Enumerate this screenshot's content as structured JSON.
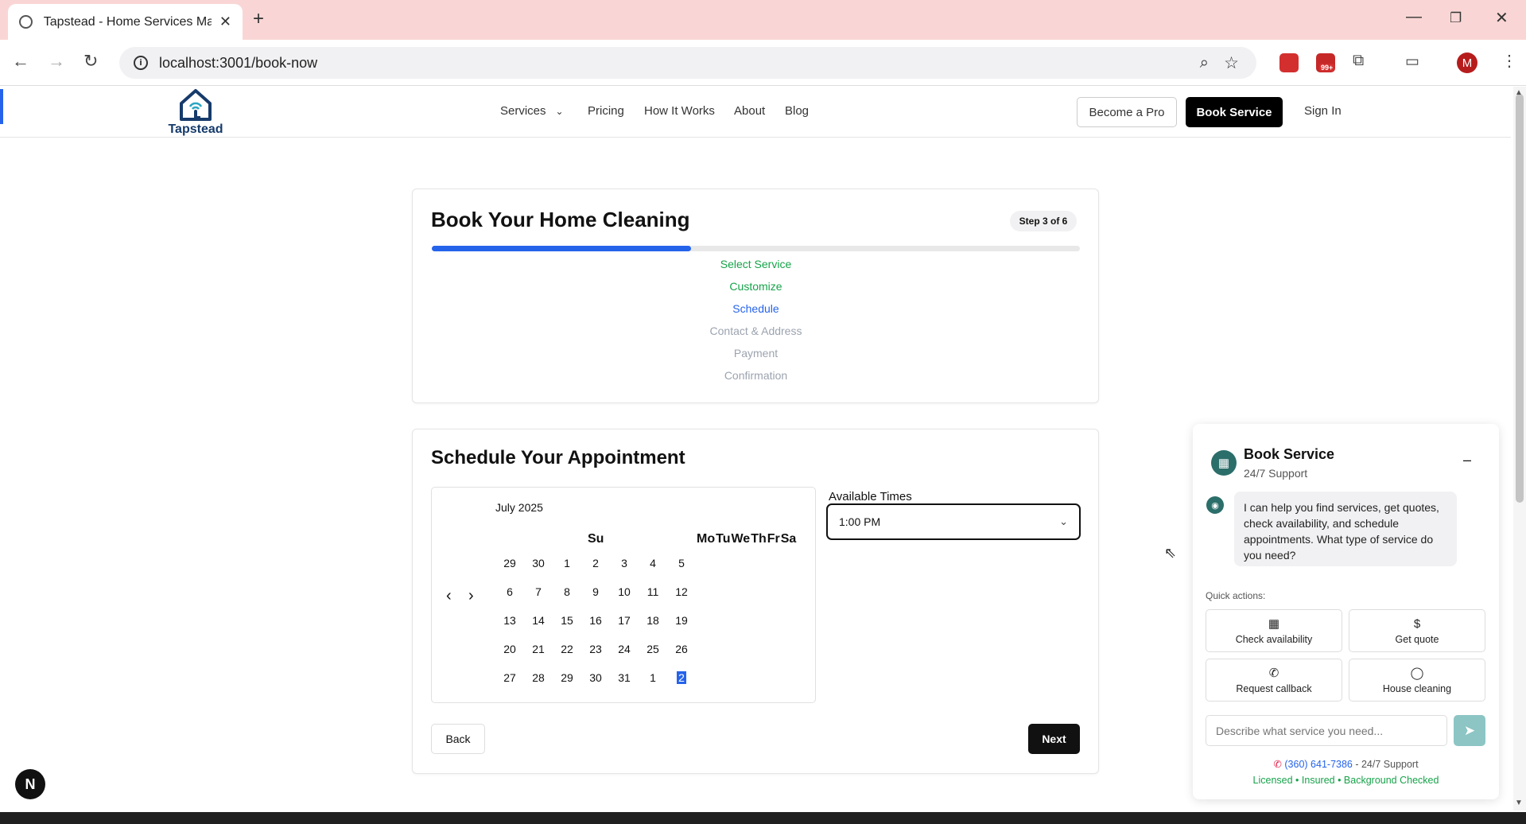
{
  "browser": {
    "tab_title": "Tapstead - Home Services Made",
    "url": "localhost:3001/book-now",
    "profile_initial": "M",
    "ext_badge": "99+"
  },
  "header": {
    "logo_text": "Tapstead",
    "nav": [
      "Services",
      "Pricing",
      "How It Works",
      "About",
      "Blog"
    ],
    "become_pro": "Become a Pro",
    "book_service": "Book Service",
    "sign_in": "Sign In"
  },
  "progress": {
    "title": "Book Your Home Cleaning",
    "step_badge": "Step 3 of 6",
    "progress_fraction": 0.4,
    "steps": [
      {
        "label": "Select Service",
        "state": "done"
      },
      {
        "label": "Customize",
        "state": "done"
      },
      {
        "label": "Schedule",
        "state": "current"
      },
      {
        "label": "Contact & Address",
        "state": "pending"
      },
      {
        "label": "Payment",
        "state": "pending"
      },
      {
        "label": "Confirmation",
        "state": "pending"
      }
    ],
    "colors": {
      "done": "#16a34a",
      "current": "#2563eb",
      "pending": "#9ca3af"
    }
  },
  "schedule": {
    "title": "Schedule Your Appointment",
    "calendar": {
      "month": "July 2025",
      "weekdays_first": "Su",
      "weekdays_rest": [
        "Mo",
        "Tu",
        "We",
        "Th",
        "Fr",
        "Sa"
      ],
      "weeks": [
        [
          "29",
          "30",
          "1",
          "2",
          "3",
          "4",
          "5"
        ],
        [
          "6",
          "7",
          "8",
          "9",
          "10",
          "11",
          "12"
        ],
        [
          "13",
          "14",
          "15",
          "16",
          "17",
          "18",
          "19"
        ],
        [
          "20",
          "21",
          "22",
          "23",
          "24",
          "25",
          "26"
        ],
        [
          "27",
          "28",
          "29",
          "30",
          "31",
          "1",
          "2"
        ]
      ],
      "selected": "2"
    },
    "times_label": "Available Times",
    "selected_time": "1:00 PM",
    "back": "Back",
    "next": "Next"
  },
  "chat": {
    "title": "Book Service",
    "subtitle": "24/7 Support",
    "minimize": "–",
    "bot_message": "I can help you find services, get quotes, check availability, and schedule appointments. What type of service do you need?",
    "quick_actions_label": "Quick actions:",
    "quick_actions": [
      "Check availability",
      "Get quote",
      "Request callback",
      "House cleaning"
    ],
    "input_placeholder": "Describe what service you need...",
    "phone": "(360) 641-7386",
    "phone_suffix": " - 24/7 Support",
    "badges": "Licensed • Insured • Background Checked"
  },
  "dev_badge": "N"
}
